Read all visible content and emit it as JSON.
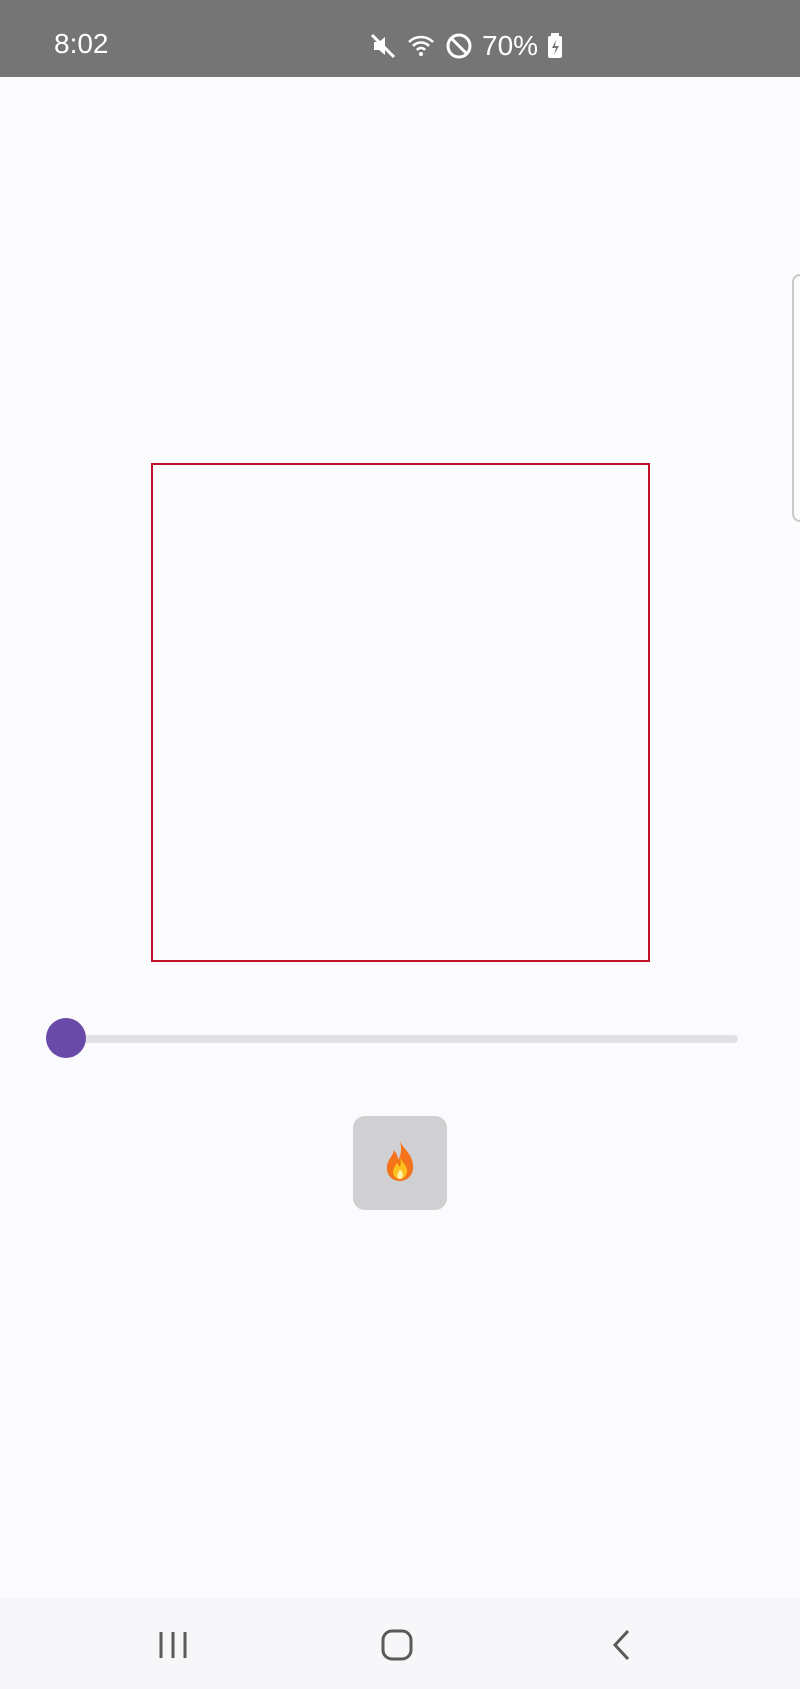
{
  "status_bar": {
    "time": "8:02",
    "battery_percent": "70%",
    "icons": [
      "mute-icon",
      "wifi-icon",
      "do-not-disturb-icon",
      "battery-charging-icon"
    ]
  },
  "canvas": {
    "border_color": "#c0112b"
  },
  "slider": {
    "value_fraction": 0,
    "color": "#6a4aa8",
    "track_color": "#e3e0e8"
  },
  "fire_button": {
    "icon": "fire-icon",
    "emoji": "🔥"
  },
  "nav_bar": {
    "items": [
      "recent-apps-icon",
      "home-icon",
      "back-icon"
    ]
  }
}
